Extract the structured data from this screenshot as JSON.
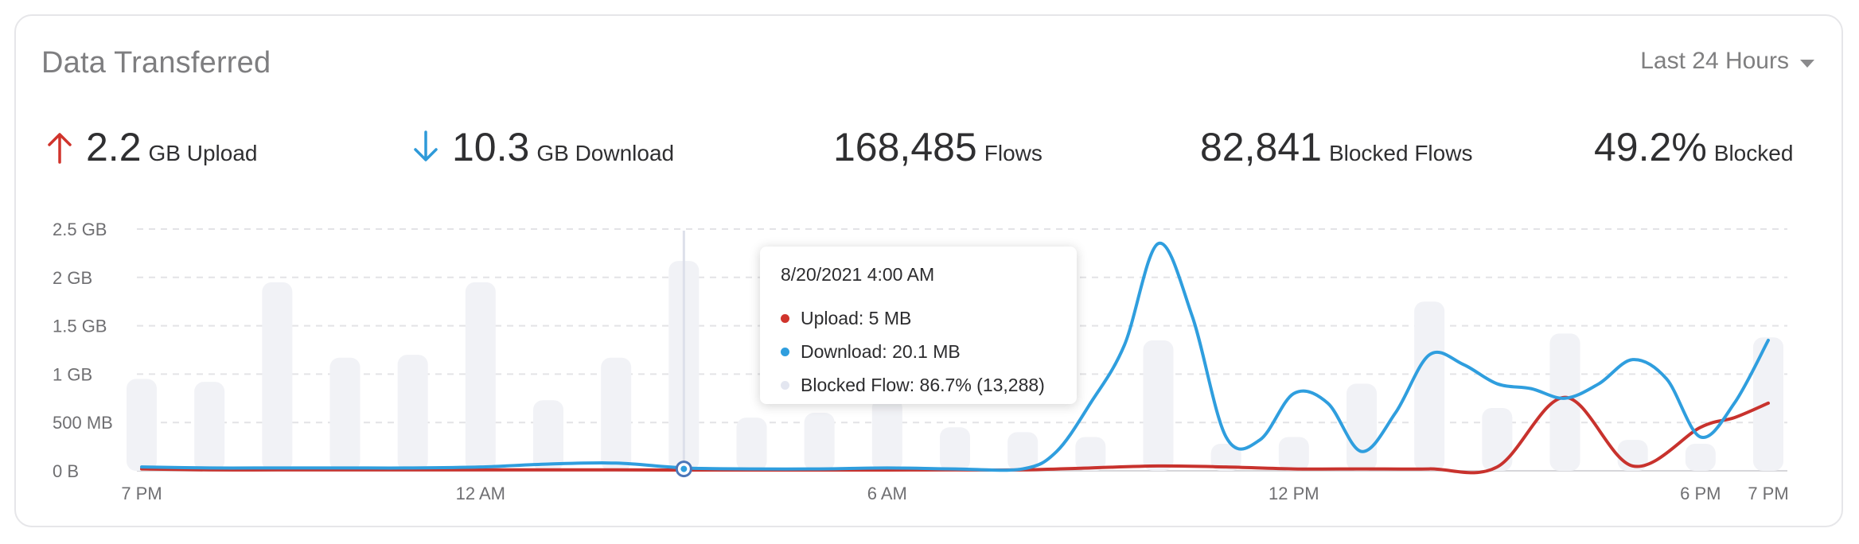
{
  "header": {
    "title": "Data Transferred",
    "range_label": "Last 24 Hours"
  },
  "stats": [
    {
      "value": "2.2",
      "label": "GB Upload",
      "icon": "arrow-up-icon",
      "color": "#d0342c"
    },
    {
      "value": "10.3",
      "label": "GB Download",
      "icon": "arrow-down-icon",
      "color": "#2e9ad9"
    },
    {
      "value": "168,485",
      "label": "Flows"
    },
    {
      "value": "82,841",
      "label": "Blocked Flows"
    },
    {
      "value": "49.2%",
      "label": "Blocked"
    }
  ],
  "colors": {
    "upload": "#c8322d",
    "download": "#2f9ede",
    "blocked": "#f1f2f6",
    "grid": "#e3e3e6"
  },
  "chart_data": {
    "type": "line",
    "ylim": [
      0,
      2.5
    ],
    "y_ticks": [
      {
        "value": 0,
        "label": "0 B"
      },
      {
        "value": 0.5,
        "label": "500 MB"
      },
      {
        "value": 1,
        "label": "1 GB"
      },
      {
        "value": 1.5,
        "label": "1.5 GB"
      },
      {
        "value": 2,
        "label": "2 GB"
      },
      {
        "value": 2.5,
        "label": "2.5 GB"
      }
    ],
    "x_range_hours": [
      0,
      24
    ],
    "x_ticks": [
      {
        "hour": 0,
        "label": "7 PM"
      },
      {
        "hour": 5,
        "label": "12 AM"
      },
      {
        "hour": 11,
        "label": "6 AM"
      },
      {
        "hour": 17,
        "label": "12 PM"
      },
      {
        "hour": 23,
        "label": "6 PM"
      },
      {
        "hour": 24,
        "label": "7 PM"
      }
    ],
    "series": [
      {
        "name": "Upload",
        "key": "upload",
        "x": [
          0,
          1,
          2,
          3,
          4,
          5,
          6,
          7,
          8,
          9,
          10,
          11,
          12,
          13,
          14,
          15,
          16,
          17,
          18,
          19,
          20,
          21,
          22,
          23,
          23.5,
          24
        ],
        "values": [
          0.02,
          0.01,
          0.01,
          0.01,
          0.01,
          0.01,
          0.01,
          0.01,
          0.005,
          0.005,
          0.005,
          0.005,
          0.01,
          0.01,
          0.03,
          0.05,
          0.04,
          0.02,
          0.02,
          0.02,
          0.04,
          0.76,
          0.05,
          0.45,
          0.55,
          0.7
        ]
      },
      {
        "name": "Download",
        "key": "download",
        "x": [
          0,
          1,
          2,
          3,
          4,
          5,
          6,
          7,
          8,
          9,
          10,
          11,
          12,
          13,
          13.5,
          14,
          14.5,
          15,
          15.5,
          16,
          16.5,
          17,
          17.5,
          18,
          18.5,
          19,
          19.5,
          20,
          20.5,
          21,
          21.5,
          22,
          22.5,
          23,
          23.5,
          24
        ],
        "values": [
          0.04,
          0.03,
          0.03,
          0.03,
          0.03,
          0.04,
          0.07,
          0.08,
          0.03,
          0.02,
          0.02,
          0.03,
          0.02,
          0.02,
          0.2,
          0.7,
          1.3,
          2.35,
          1.6,
          0.35,
          0.32,
          0.8,
          0.7,
          0.2,
          0.6,
          1.2,
          1.1,
          0.9,
          0.85,
          0.75,
          0.9,
          1.15,
          0.95,
          0.35,
          0.7,
          1.35
        ]
      }
    ],
    "blocked_bars": {
      "x": [
        0,
        1,
        2,
        3,
        4,
        5,
        6,
        7,
        8,
        9,
        10,
        11,
        12,
        13,
        14,
        15,
        16,
        17,
        18,
        19,
        20,
        21,
        22,
        23,
        24
      ],
      "values": [
        0.95,
        0.92,
        1.95,
        1.17,
        1.2,
        1.95,
        0.73,
        1.17,
        2.17,
        0.55,
        0.6,
        0.75,
        0.45,
        0.4,
        0.35,
        1.35,
        0.28,
        0.35,
        0.9,
        1.75,
        0.65,
        1.42,
        0.32,
        0.28,
        1.38
      ]
    },
    "hover": {
      "hour": 8,
      "value": 0.02
    },
    "tooltip": {
      "date": "8/20/2021 4:00 AM",
      "rows": [
        {
          "text": "Upload: 5 MB",
          "color": "#d0342c"
        },
        {
          "text": "Download: 20.1 MB",
          "color": "#2f9ede"
        },
        {
          "text": "Blocked Flow: 86.7% (13,288)",
          "color": "#e3e6f0"
        }
      ]
    }
  }
}
